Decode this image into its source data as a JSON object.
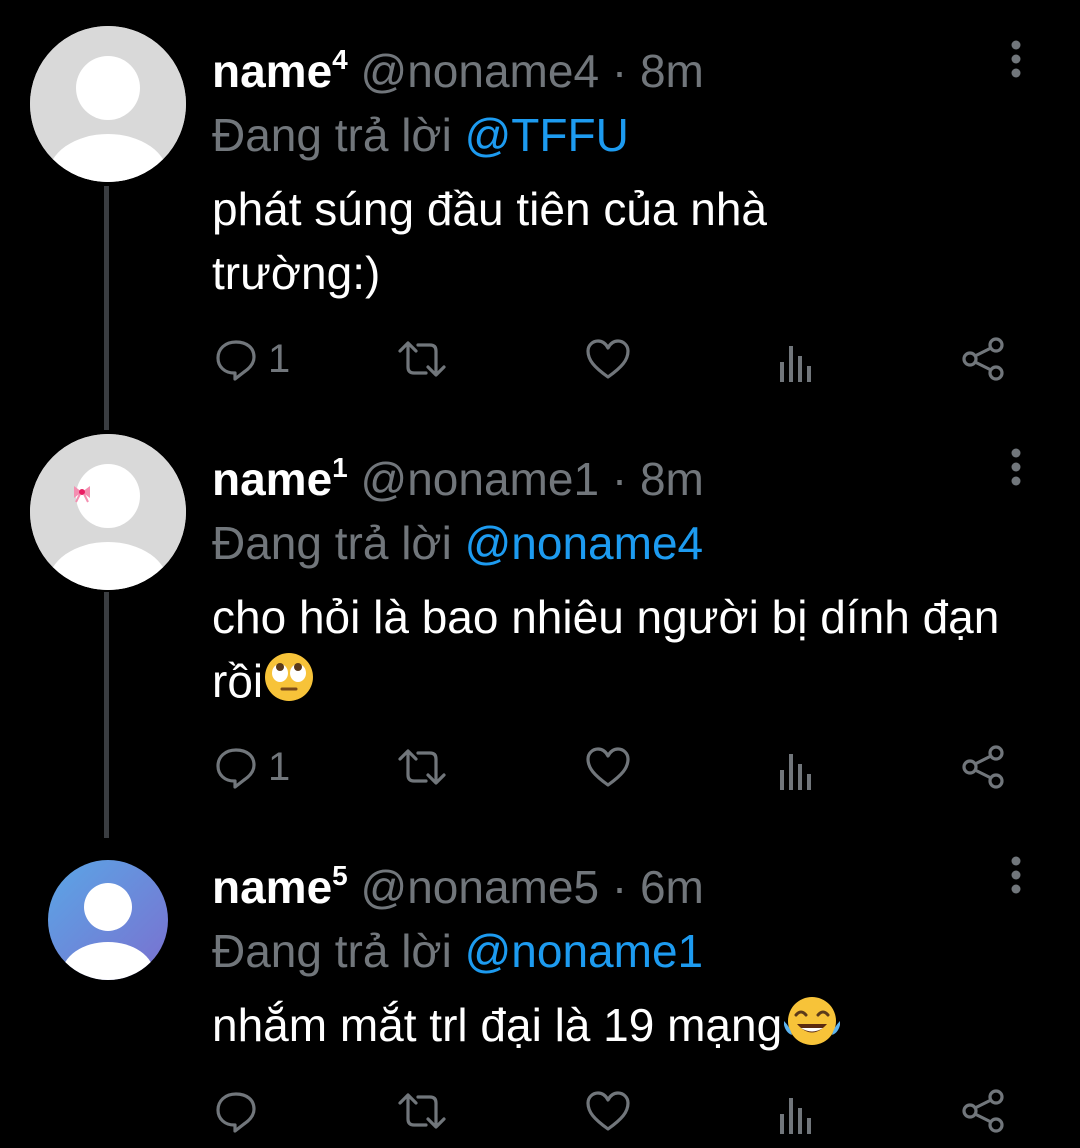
{
  "tweets": [
    {
      "display_name": "name",
      "name_sup": "4",
      "handle": "@noname4",
      "separator": "·",
      "time": "8m",
      "reply_prefix": "Đang trả lời",
      "reply_to": "@TFFU",
      "text": "phát súng đầu tiên của nhà trường:)",
      "reply_count": "1",
      "avatar_color": "#d9d9d9"
    },
    {
      "display_name": "name",
      "name_sup": "1",
      "handle": "@noname1",
      "separator": "·",
      "time": "8m",
      "reply_prefix": "Đang trả lời",
      "reply_to": "@noname4",
      "text": "cho hỏi là bao nhiêu người bị dính đạn rồi",
      "text_emoji": "face-with-rolling-eyes",
      "reply_count": "1",
      "avatar_color": "#d9d9d9",
      "avatar_accessory": "pink-bow"
    },
    {
      "display_name": "name",
      "name_sup": "5",
      "handle": "@noname5",
      "separator": "·",
      "time": "6m",
      "reply_prefix": "Đang trả lời",
      "reply_to": "@noname1",
      "text": "nhắm mắt trl đại là 19 mạng",
      "text_emoji": "face-with-tears-of-joy",
      "reply_count": "",
      "avatar_color": "#6a8fd8"
    }
  ],
  "colors": {
    "background": "#000000",
    "muted": "#71767b",
    "mention": "#1d9bf0",
    "thread_line": "#3a3d41"
  },
  "icons": [
    "reply-icon",
    "retweet-icon",
    "like-icon",
    "views-icon",
    "share-icon",
    "more-options-icon"
  ]
}
